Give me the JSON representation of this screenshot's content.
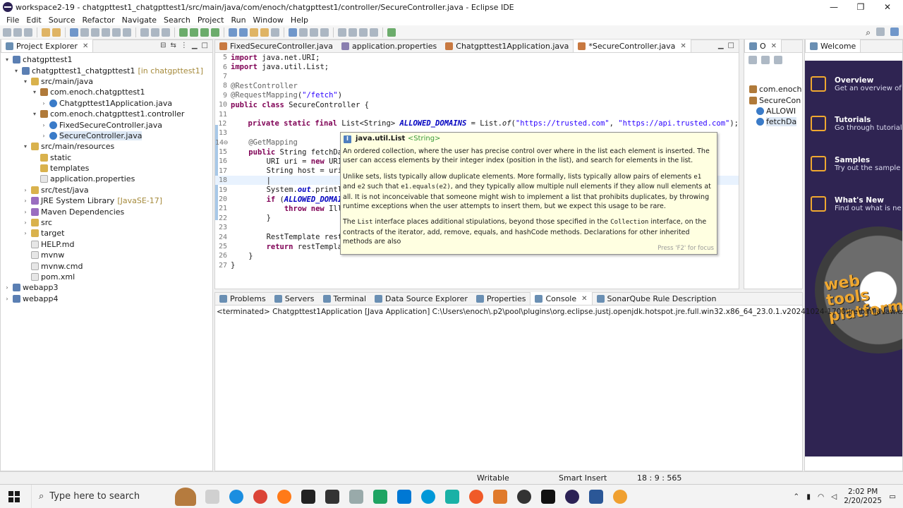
{
  "window": {
    "title": "workspace2-19 - chatgpttest1_chatgpttest1/src/main/java/com/enoch/chatgpttest1/controller/SecureController.java - Eclipse IDE",
    "minimize": "—",
    "maximize": "❐",
    "close": "✕"
  },
  "menu": [
    "File",
    "Edit",
    "Source",
    "Refactor",
    "Navigate",
    "Search",
    "Project",
    "Run",
    "Window",
    "Help"
  ],
  "project_explorer": {
    "tab_label": "Project Explorer",
    "items": [
      {
        "label": "chatgpttest1",
        "extra": "",
        "indent": 0,
        "twisty": "▾",
        "icon": "proj"
      },
      {
        "label": "chatgpttest1_chatgpttest1",
        "extra": "[in chatgpttest1]",
        "indent": 1,
        "twisty": "▾",
        "icon": "proj"
      },
      {
        "label": "src/main/java",
        "extra": "",
        "indent": 2,
        "twisty": "▾",
        "icon": "folder"
      },
      {
        "label": "com.enoch.chatgpttest1",
        "extra": "",
        "indent": 3,
        "twisty": "▾",
        "icon": "pkg"
      },
      {
        "label": "Chatgpttest1Application.java",
        "extra": "",
        "indent": 4,
        "twisty": "›",
        "icon": "java"
      },
      {
        "label": "com.enoch.chatgpttest1.controller",
        "extra": "",
        "indent": 3,
        "twisty": "▾",
        "icon": "pkg"
      },
      {
        "label": "FixedSecureController.java",
        "extra": "",
        "indent": 4,
        "twisty": "›",
        "icon": "java"
      },
      {
        "label": "SecureController.java",
        "extra": "",
        "indent": 4,
        "twisty": "›",
        "icon": "java",
        "selected": true
      },
      {
        "label": "src/main/resources",
        "extra": "",
        "indent": 2,
        "twisty": "▾",
        "icon": "folder"
      },
      {
        "label": "static",
        "extra": "",
        "indent": 3,
        "twisty": "",
        "icon": "folder"
      },
      {
        "label": "templates",
        "extra": "",
        "indent": 3,
        "twisty": "",
        "icon": "folder"
      },
      {
        "label": "application.properties",
        "extra": "",
        "indent": 3,
        "twisty": "",
        "icon": "file"
      },
      {
        "label": "src/test/java",
        "extra": "",
        "indent": 2,
        "twisty": "›",
        "icon": "folder"
      },
      {
        "label": "JRE System Library",
        "extra": "[JavaSE-17]",
        "indent": 2,
        "twisty": "›",
        "icon": "lib"
      },
      {
        "label": "Maven Dependencies",
        "extra": "",
        "indent": 2,
        "twisty": "›",
        "icon": "lib"
      },
      {
        "label": "src",
        "extra": "",
        "indent": 2,
        "twisty": "›",
        "icon": "folder"
      },
      {
        "label": "target",
        "extra": "",
        "indent": 2,
        "twisty": "›",
        "icon": "folder"
      },
      {
        "label": "HELP.md",
        "extra": "",
        "indent": 2,
        "twisty": "",
        "icon": "file"
      },
      {
        "label": "mvnw",
        "extra": "",
        "indent": 2,
        "twisty": "",
        "icon": "file"
      },
      {
        "label": "mvnw.cmd",
        "extra": "",
        "indent": 2,
        "twisty": "",
        "icon": "file"
      },
      {
        "label": "pom.xml",
        "extra": "",
        "indent": 2,
        "twisty": "",
        "icon": "file"
      },
      {
        "label": "webapp3",
        "extra": "",
        "indent": 0,
        "twisty": "›",
        "icon": "proj"
      },
      {
        "label": "webapp4",
        "extra": "",
        "indent": 0,
        "twisty": "›",
        "icon": "proj"
      }
    ]
  },
  "editor": {
    "tabs": [
      {
        "label": "FixedSecureController.java",
        "icon": "j"
      },
      {
        "label": "application.properties",
        "icon": "p"
      },
      {
        "label": "Chatgpttest1Application.java",
        "icon": "j"
      },
      {
        "label": "*SecureController.java",
        "icon": "j",
        "active": true
      }
    ],
    "lines": [
      {
        "n": "5",
        "html": "<span class=\"kw\">import</span> java.net.URI;"
      },
      {
        "n": "6",
        "html": "<span class=\"kw\">import</span> java.util.List;"
      },
      {
        "n": "7",
        "html": ""
      },
      {
        "n": "8",
        "html": "<span class=\"ann\">@RestController</span>"
      },
      {
        "n": "9",
        "html": "<span class=\"ann\">@RequestMapping</span>(<span class=\"str\">\"/fetch\"</span>)"
      },
      {
        "n": "10",
        "html": "<span class=\"kw\">public class</span> SecureController {"
      },
      {
        "n": "11",
        "html": ""
      },
      {
        "n": "12",
        "html": "    <span class=\"kw\">private static final</span> List&lt;String&gt; <span class=\"fld\">ALLOWED_DOMAINS</span> = List.<span class=\"ital\">of</span>(<span class=\"str\">\"https://trusted.com\"</span>, <span class=\"str\">\"https://api.trusted.com\"</span>);"
      },
      {
        "n": "13",
        "html": ""
      },
      {
        "n": "14⊖",
        "html": "    <span class=\"ann\">@GetMapping</span>"
      },
      {
        "n": "15",
        "html": "    <span class=\"kw\">public</span> String fetchDa"
      },
      {
        "n": "16",
        "html": "        URI uri = <span class=\"kw\">new</span> URI"
      },
      {
        "n": "17",
        "html": "        String host = uri"
      },
      {
        "n": "18",
        "html": "        |",
        "cur": true
      },
      {
        "n": "19",
        "html": "        System.<span class=\"fld\">out</span>.printl"
      },
      {
        "n": "20",
        "html": "        <span class=\"kw\">if</span> (<span class=\"fld\">ALLOWED_DOMAI</span>"
      },
      {
        "n": "21",
        "html": "            <span class=\"kw\">throw new</span> Ill"
      },
      {
        "n": "22",
        "html": "        }"
      },
      {
        "n": "23",
        "html": ""
      },
      {
        "n": "24",
        "html": "        RestTemplate rest"
      },
      {
        "n": "25",
        "html": "        <span class=\"kw\">return</span> restTempla"
      },
      {
        "n": "26",
        "html": "    }"
      },
      {
        "n": "27",
        "html": "}"
      }
    ]
  },
  "hover": {
    "title": "java.util.List",
    "generic": "<String>",
    "p1": "An ordered collection, where the user has precise control over where in the list each element is inserted. The user can access elements by their integer index (position in the list), and search for elements in the list.",
    "p2a": "Unlike sets, lists typically allow duplicate elements. More formally, lists typically allow pairs of elements ",
    "p2b": "e1",
    "p2c": " and ",
    "p2d": "e2",
    "p2e": " such that ",
    "p2f": "e1.equals(e2)",
    "p2g": ", and they typically allow multiple null elements if they allow null elements at all. It is not inconceivable that someone might wish to implement a list that prohibits duplicates, by throwing runtime exceptions when the user attempts to insert them, but we expect this usage to be rare.",
    "p3a": "The ",
    "p3b": "List",
    "p3c": " interface places additional stipulations, beyond those specified in the ",
    "p3d": "Collection",
    "p3e": " interface, on the contracts of the iterator, add, remove, equals, and hashCode methods. Declarations for other inherited methods are also",
    "footer": "Press 'F2' for focus"
  },
  "outline": {
    "tab_label": "O",
    "items": [
      {
        "label": "com.enoch",
        "indent": 0
      },
      {
        "label": "SecureCon",
        "indent": 0
      },
      {
        "label": "ALLOWI",
        "indent": 1
      },
      {
        "label": "fetchDa",
        "indent": 1,
        "selected": true
      }
    ]
  },
  "welcome": {
    "tab_label": "Welcome",
    "items": [
      {
        "title": "Overview",
        "desc": "Get an overview of"
      },
      {
        "title": "Tutorials",
        "desc": "Go through tutorial"
      },
      {
        "title": "Samples",
        "desc": "Try out the sample"
      },
      {
        "title": "What's New",
        "desc": "Find out what is ne"
      }
    ],
    "logo_text": "web tools platform"
  },
  "bottom": {
    "tabs": [
      {
        "label": "Problems"
      },
      {
        "label": "Servers"
      },
      {
        "label": "Terminal"
      },
      {
        "label": "Data Source Explorer"
      },
      {
        "label": "Properties"
      },
      {
        "label": "Console",
        "active": true
      },
      {
        "label": "SonarQube Rule Description"
      }
    ],
    "console_text": "<terminated> Chatgpttest1Application [Java Application] C:\\Users\\enoch\\.p2\\pool\\plugins\\org.eclipse.justj.openjdk.hotspot.jre.full.win32.x86_64_23.0.1.v20241024-1700\\jre\\bin\\javaw.exe  (F"
  },
  "status": {
    "writable": "Writable",
    "insert": "Smart Insert",
    "position": "18 : 9 : 565"
  },
  "taskbar": {
    "search_placeholder": "Type here to search",
    "time": "2:02 PM",
    "date": "2/20/2025"
  },
  "colors": {
    "welcome_bg": "#2f2452",
    "accent": "#f0a830",
    "hover_bg": "#ffffe1"
  }
}
